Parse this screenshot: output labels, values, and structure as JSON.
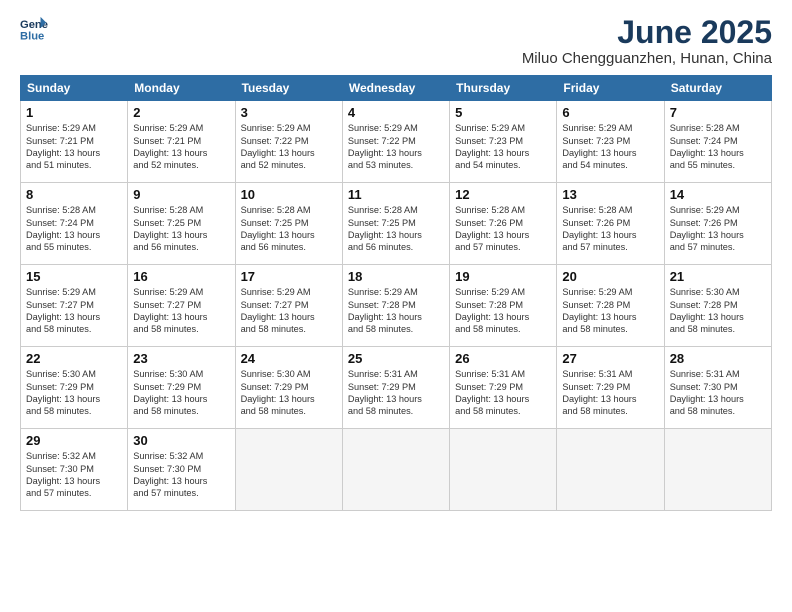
{
  "header": {
    "logo_line1": "General",
    "logo_line2": "Blue",
    "month": "June 2025",
    "location": "Miluo Chengguanzhen, Hunan, China"
  },
  "weekdays": [
    "Sunday",
    "Monday",
    "Tuesday",
    "Wednesday",
    "Thursday",
    "Friday",
    "Saturday"
  ],
  "weeks": [
    [
      {
        "day": "1",
        "info": "Sunrise: 5:29 AM\nSunset: 7:21 PM\nDaylight: 13 hours\nand 51 minutes."
      },
      {
        "day": "2",
        "info": "Sunrise: 5:29 AM\nSunset: 7:21 PM\nDaylight: 13 hours\nand 52 minutes."
      },
      {
        "day": "3",
        "info": "Sunrise: 5:29 AM\nSunset: 7:22 PM\nDaylight: 13 hours\nand 52 minutes."
      },
      {
        "day": "4",
        "info": "Sunrise: 5:29 AM\nSunset: 7:22 PM\nDaylight: 13 hours\nand 53 minutes."
      },
      {
        "day": "5",
        "info": "Sunrise: 5:29 AM\nSunset: 7:23 PM\nDaylight: 13 hours\nand 54 minutes."
      },
      {
        "day": "6",
        "info": "Sunrise: 5:29 AM\nSunset: 7:23 PM\nDaylight: 13 hours\nand 54 minutes."
      },
      {
        "day": "7",
        "info": "Sunrise: 5:28 AM\nSunset: 7:24 PM\nDaylight: 13 hours\nand 55 minutes."
      }
    ],
    [
      {
        "day": "8",
        "info": "Sunrise: 5:28 AM\nSunset: 7:24 PM\nDaylight: 13 hours\nand 55 minutes."
      },
      {
        "day": "9",
        "info": "Sunrise: 5:28 AM\nSunset: 7:25 PM\nDaylight: 13 hours\nand 56 minutes."
      },
      {
        "day": "10",
        "info": "Sunrise: 5:28 AM\nSunset: 7:25 PM\nDaylight: 13 hours\nand 56 minutes."
      },
      {
        "day": "11",
        "info": "Sunrise: 5:28 AM\nSunset: 7:25 PM\nDaylight: 13 hours\nand 56 minutes."
      },
      {
        "day": "12",
        "info": "Sunrise: 5:28 AM\nSunset: 7:26 PM\nDaylight: 13 hours\nand 57 minutes."
      },
      {
        "day": "13",
        "info": "Sunrise: 5:28 AM\nSunset: 7:26 PM\nDaylight: 13 hours\nand 57 minutes."
      },
      {
        "day": "14",
        "info": "Sunrise: 5:29 AM\nSunset: 7:26 PM\nDaylight: 13 hours\nand 57 minutes."
      }
    ],
    [
      {
        "day": "15",
        "info": "Sunrise: 5:29 AM\nSunset: 7:27 PM\nDaylight: 13 hours\nand 58 minutes."
      },
      {
        "day": "16",
        "info": "Sunrise: 5:29 AM\nSunset: 7:27 PM\nDaylight: 13 hours\nand 58 minutes."
      },
      {
        "day": "17",
        "info": "Sunrise: 5:29 AM\nSunset: 7:27 PM\nDaylight: 13 hours\nand 58 minutes."
      },
      {
        "day": "18",
        "info": "Sunrise: 5:29 AM\nSunset: 7:28 PM\nDaylight: 13 hours\nand 58 minutes."
      },
      {
        "day": "19",
        "info": "Sunrise: 5:29 AM\nSunset: 7:28 PM\nDaylight: 13 hours\nand 58 minutes."
      },
      {
        "day": "20",
        "info": "Sunrise: 5:29 AM\nSunset: 7:28 PM\nDaylight: 13 hours\nand 58 minutes."
      },
      {
        "day": "21",
        "info": "Sunrise: 5:30 AM\nSunset: 7:28 PM\nDaylight: 13 hours\nand 58 minutes."
      }
    ],
    [
      {
        "day": "22",
        "info": "Sunrise: 5:30 AM\nSunset: 7:29 PM\nDaylight: 13 hours\nand 58 minutes."
      },
      {
        "day": "23",
        "info": "Sunrise: 5:30 AM\nSunset: 7:29 PM\nDaylight: 13 hours\nand 58 minutes."
      },
      {
        "day": "24",
        "info": "Sunrise: 5:30 AM\nSunset: 7:29 PM\nDaylight: 13 hours\nand 58 minutes."
      },
      {
        "day": "25",
        "info": "Sunrise: 5:31 AM\nSunset: 7:29 PM\nDaylight: 13 hours\nand 58 minutes."
      },
      {
        "day": "26",
        "info": "Sunrise: 5:31 AM\nSunset: 7:29 PM\nDaylight: 13 hours\nand 58 minutes."
      },
      {
        "day": "27",
        "info": "Sunrise: 5:31 AM\nSunset: 7:29 PM\nDaylight: 13 hours\nand 58 minutes."
      },
      {
        "day": "28",
        "info": "Sunrise: 5:31 AM\nSunset: 7:30 PM\nDaylight: 13 hours\nand 58 minutes."
      }
    ],
    [
      {
        "day": "29",
        "info": "Sunrise: 5:32 AM\nSunset: 7:30 PM\nDaylight: 13 hours\nand 57 minutes."
      },
      {
        "day": "30",
        "info": "Sunrise: 5:32 AM\nSunset: 7:30 PM\nDaylight: 13 hours\nand 57 minutes."
      },
      {
        "day": "",
        "info": ""
      },
      {
        "day": "",
        "info": ""
      },
      {
        "day": "",
        "info": ""
      },
      {
        "day": "",
        "info": ""
      },
      {
        "day": "",
        "info": ""
      }
    ]
  ]
}
